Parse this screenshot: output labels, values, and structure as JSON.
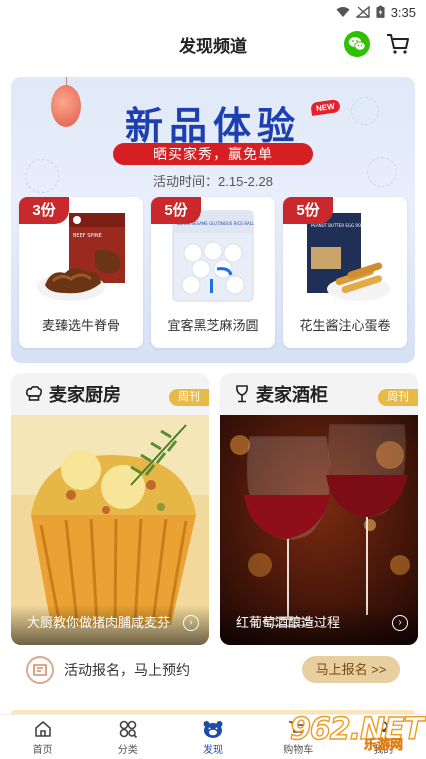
{
  "status_bar": {
    "time": "3:35"
  },
  "header": {
    "title": "发现频道"
  },
  "banner": {
    "title": "新品体验",
    "new_badge": "NEW",
    "subtitle": "晒买家秀，赢免单",
    "activity_time": "活动时间：2.15-2.28",
    "products": [
      {
        "qty": "3份",
        "name": "麦臻选牛脊骨",
        "pack_text": "BEEF SPINE"
      },
      {
        "qty": "5份",
        "name": "宜客黑芝麻汤圆",
        "pack_text": "BLACK SESAME GLUTINOUS RICE BALL"
      },
      {
        "qty": "5份",
        "name": "花生酱注心蛋卷",
        "pack_text": "PEANUT BUTTER EGG ROLLS"
      }
    ]
  },
  "sections": [
    {
      "title": "麦家厨房",
      "tag": "周刊",
      "caption": "大厨教你做猪肉脯咸麦芬",
      "icon": "chef-hat-icon"
    },
    {
      "title": "麦家酒柜",
      "tag": "周刊",
      "caption": "红葡萄酒酿造过程",
      "icon": "wine-glass-icon"
    }
  ],
  "signup": {
    "text": "活动报名，马上预约",
    "button": "马上报名 >>"
  },
  "nav": [
    {
      "label": "首页",
      "icon": "home-icon",
      "active": false
    },
    {
      "label": "分类",
      "icon": "category-icon",
      "active": false
    },
    {
      "label": "发现",
      "icon": "discover-bear-icon",
      "active": true
    },
    {
      "label": "购物车",
      "icon": "cart-icon",
      "active": false
    },
    {
      "label": "我的",
      "icon": "profile-icon",
      "active": false
    }
  ],
  "watermark": {
    "logo": "962.NET",
    "sub": "乐游网"
  },
  "colors": {
    "accent_blue": "#1e3fb0",
    "accent_red": "#d51f22",
    "gold": "#e7b948",
    "wechat_green": "#2dc100"
  }
}
